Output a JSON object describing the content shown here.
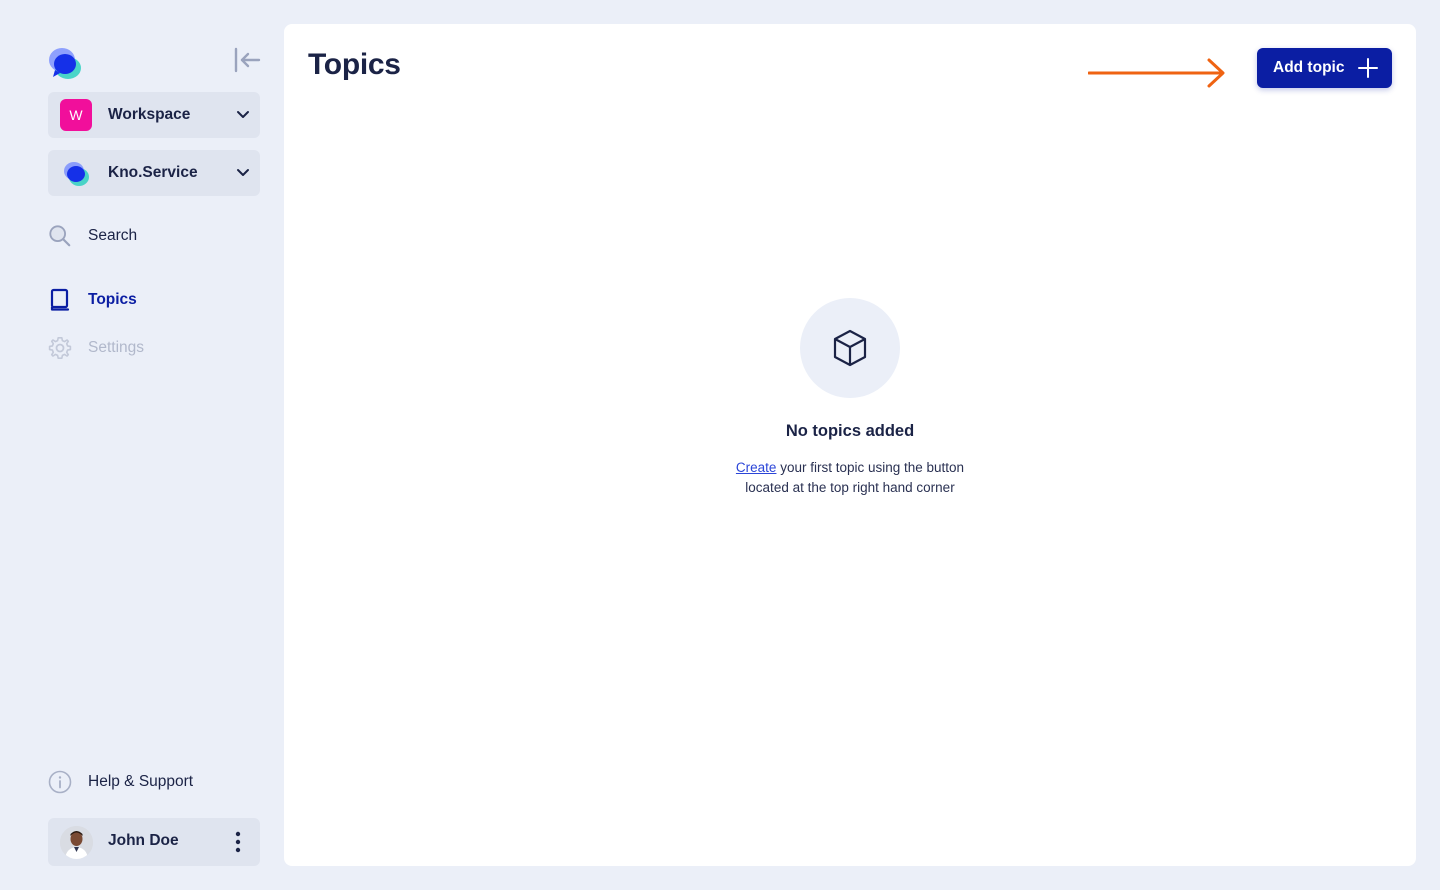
{
  "colors": {
    "background": "#ebeff8",
    "panel": "#ffffff",
    "primary": "#0b1ea3",
    "workspace_badge": "#f10f9b",
    "annotation_arrow": "#ef6312",
    "text_dark": "#1b2346",
    "text_disabled": "#b1b8cb"
  },
  "sidebar": {
    "logo_icon": "chat-bubble-logo-icon",
    "collapse_icon": "collapse-left-icon",
    "workspace": {
      "badge": "W",
      "label": "Workspace"
    },
    "service": {
      "label": "Kno.Service"
    },
    "nav": {
      "search": {
        "label": "Search",
        "icon": "search-icon"
      },
      "topics": {
        "label": "Topics",
        "icon": "book-icon",
        "active": true
      },
      "settings": {
        "label": "Settings",
        "icon": "gear-icon",
        "disabled": true
      }
    },
    "help": {
      "label": "Help & Support",
      "icon": "info-icon"
    },
    "user": {
      "name": "John Doe",
      "menu_icon": "kebab-icon"
    }
  },
  "main": {
    "title": "Topics",
    "add_button": {
      "label": "Add topic",
      "icon": "plus-icon"
    },
    "empty_state": {
      "icon": "cube-icon",
      "title": "No topics added",
      "link_text": "Create",
      "description": " your first topic using the button located at the top right hand corner"
    }
  }
}
